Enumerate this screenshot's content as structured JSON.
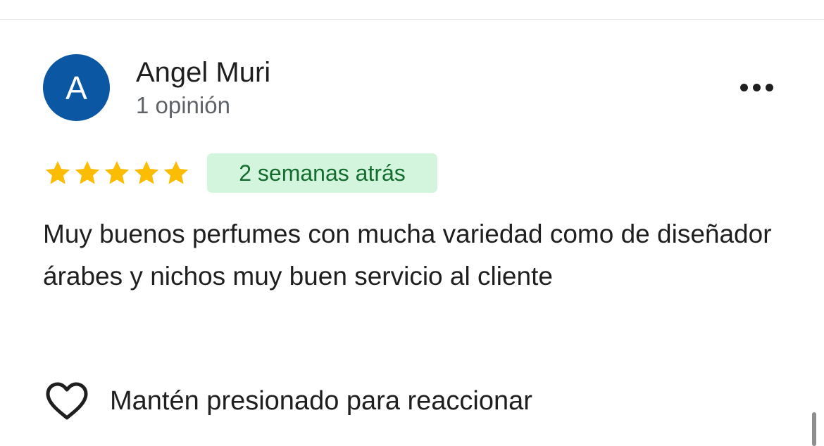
{
  "review": {
    "avatar_letter": "A",
    "author_name": "Angel Muri",
    "review_count": "1 opinión",
    "rating": 5,
    "rating_max": 5,
    "date": "2 semanas atrás",
    "text": "Muy buenos perfumes con mucha variedad como de diseñador árabes y nichos muy buen servicio al cliente"
  },
  "actions": {
    "more_icon": "more-horizontal-icon",
    "react_icon": "heart-outline-icon",
    "react_label": "Mantén presionado para reaccionar"
  },
  "colors": {
    "avatar_bg": "#0b57a4",
    "star": "#fbbc04",
    "date_badge_bg": "#d3f5dd",
    "date_badge_text": "#146c2e",
    "text_primary": "#1f1f1f",
    "text_secondary": "#5f6368"
  }
}
